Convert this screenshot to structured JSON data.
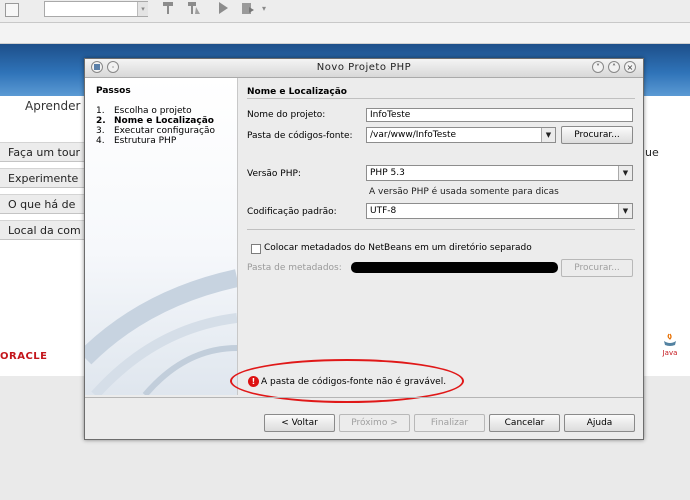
{
  "ide": {
    "toolbar_icons": [
      "hammer-icon",
      "clean-build-icon",
      "run-icon",
      "debug-icon",
      "dropdown-icon"
    ],
    "dropdown_arrow": "▾"
  },
  "start_page": {
    "learn_title": "Aprender",
    "items": [
      "Faça um tour",
      "Experimente",
      "O que há de",
      "Local da com"
    ],
    "right_fragment": "ue",
    "oracle_logo": "ORACLE",
    "java_logo": "Java"
  },
  "dialog": {
    "title": "Novo Projeto PHP",
    "steps_title": "Passos",
    "steps": [
      {
        "num": "1.",
        "label": "Escolha o projeto",
        "current": false
      },
      {
        "num": "2.",
        "label": "Nome e Localização",
        "current": true
      },
      {
        "num": "3.",
        "label": "Executar configuração",
        "current": false
      },
      {
        "num": "4.",
        "label": "Estrutura PHP",
        "current": false
      }
    ],
    "panel_title": "Nome e Localização",
    "project_name_label": "Nome do projeto:",
    "project_name_value": "InfoTeste",
    "source_folder_label": "Pasta de códigos-fonte:",
    "source_folder_value": "/var/www/InfoTeste",
    "browse_label": "Procurar...",
    "php_version_label": "Versão PHP:",
    "php_version_value": "PHP 5.3",
    "php_version_hint": "A versão PHP é usada somente para dicas",
    "encoding_label": "Codificação padrão:",
    "encoding_value": "UTF-8",
    "metadata_checkbox_label": "Colocar metadados do NetBeans em um diretório separado",
    "metadata_checked": false,
    "metadata_folder_label": "Pasta de metadados:",
    "metadata_browse_label": "Procurar...",
    "error_message": "A pasta de códigos-fonte não é gravável.",
    "buttons": {
      "back": "< Voltar",
      "next": "Próximo >",
      "finish": "Finalizar",
      "cancel": "Cancelar",
      "help": "Ajuda"
    }
  },
  "colors": {
    "error_ellipse": "#e01818",
    "oracle_red": "#c4161c",
    "banner_blue": "#2f73b8"
  }
}
